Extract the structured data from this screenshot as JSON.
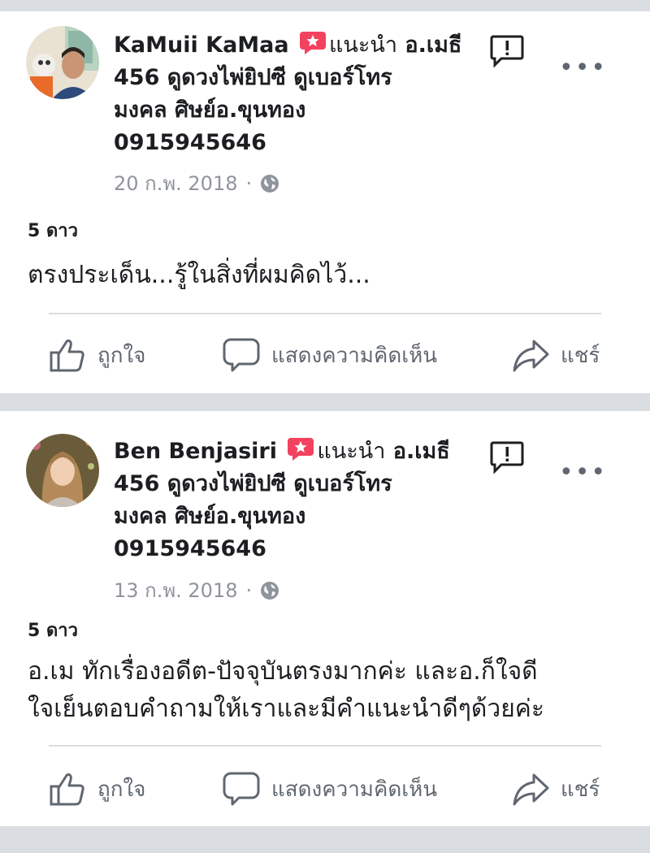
{
  "posts": [
    {
      "author": "KaMuii KaMaa",
      "recommends_label": "แนะนำ",
      "target_page_line1": "อ.เมธี",
      "target_page_line2": "456 ดูดวงไพ่ยิปซี ดูเบอร์โทร",
      "target_page_line3": "มงคล ศิษย์อ.ขุนทอง",
      "target_page_line4": "0915945646",
      "date": "20 ก.พ. 2018",
      "date_separator": "·",
      "rating": "5 ดาว",
      "body_line1": "ตรงประเด็น...รู้ในสิ่งที่ผมคิดไว้...",
      "body_line2": ""
    },
    {
      "author": "Ben Benjasiri",
      "recommends_label": "แนะนำ",
      "target_page_line1": "อ.เมธี",
      "target_page_line2": "456 ดูดวงไพ่ยิปซี ดูเบอร์โทร",
      "target_page_line3": "มงคล ศิษย์อ.ขุนทอง",
      "target_page_line4": "0915945646",
      "date": "13 ก.พ. 2018",
      "date_separator": "·",
      "rating": "5 ดาว",
      "body_line1": "อ.เม ทักเรื่องอดีต-ปัจจุบันตรงมากค่ะ และอ.ก็ใจดี",
      "body_line2": "ใจเย็นตอบคำถามให้เราและมีคำแนะนำดีๆด้วยค่ะ"
    }
  ],
  "actions": {
    "like": "ถูกใจ",
    "comment": "แสดงความคิดเห็น",
    "share": "แชร์"
  },
  "more_glyph": "•••",
  "icons": {
    "recommend": "recommend-badge-icon",
    "report": "report-flag-icon",
    "privacy": "globe-icon",
    "like": "thumbs-up-icon",
    "comment": "comment-bubble-icon",
    "share": "share-arrow-icon"
  },
  "colors": {
    "recommend_badge": "#f3425f",
    "muted": "#90949c",
    "action": "#606770",
    "divider": "#dadde1"
  }
}
